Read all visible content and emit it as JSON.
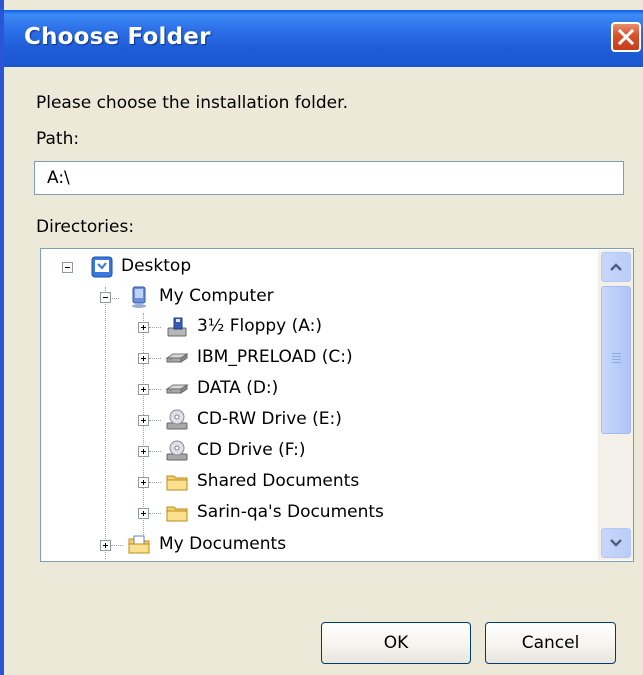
{
  "window": {
    "title": "Choose Folder"
  },
  "dialog": {
    "instruction": "Please choose the installation folder.",
    "path_label": "Path:",
    "path_value": "A:\\",
    "directories_label": "Directories:"
  },
  "tree": {
    "nodes": [
      {
        "label": "Desktop",
        "icon": "desktop-icon",
        "expanded": true
      },
      {
        "label": "My Computer",
        "icon": "computer-icon",
        "expanded": true
      },
      {
        "label": "3½ Floppy (A:)",
        "icon": "floppy-drive-icon",
        "expanded": false
      },
      {
        "label": "IBM_PRELOAD (C:)",
        "icon": "hard-drive-icon",
        "expanded": false
      },
      {
        "label": "DATA (D:)",
        "icon": "hard-drive-icon",
        "expanded": false
      },
      {
        "label": "CD-RW Drive (E:)",
        "icon": "cd-drive-icon",
        "expanded": false
      },
      {
        "label": "CD Drive (F:)",
        "icon": "cd-drive-icon",
        "expanded": false
      },
      {
        "label": "Shared Documents",
        "icon": "folder-icon",
        "expanded": false
      },
      {
        "label": "Sarin-qa's Documents",
        "icon": "folder-icon",
        "expanded": false
      },
      {
        "label": "My Documents",
        "icon": "my-documents-icon",
        "expanded": false
      }
    ]
  },
  "buttons": {
    "ok": "OK",
    "cancel": "Cancel"
  },
  "colors": {
    "titlebar": "#1e5cd6",
    "close": "#d9502b",
    "dialog_bg": "#ece9d8",
    "border": "#7f9db9"
  }
}
